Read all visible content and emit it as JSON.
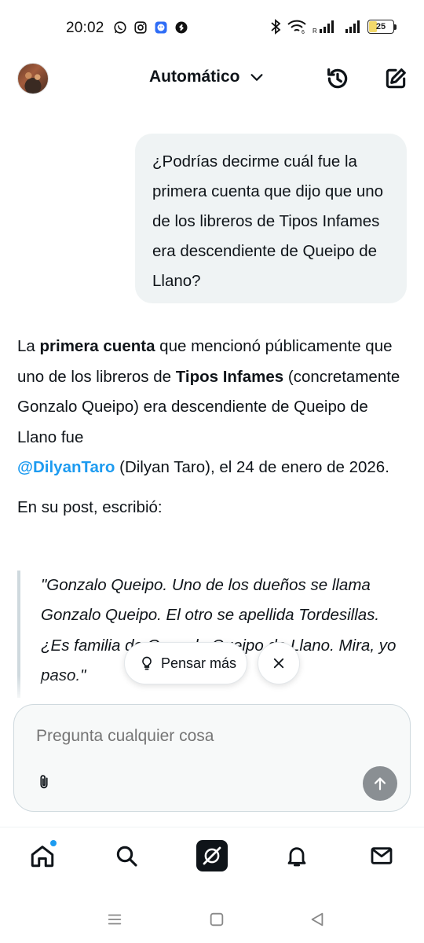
{
  "status_bar": {
    "time": "20:02",
    "battery": "25",
    "app_icons": [
      "whatsapp-icon",
      "instagram-icon",
      "bot-app-icon",
      "shazam-icon"
    ],
    "system_icons": [
      "bluetooth-icon",
      "wifi-icon",
      "signal-icon",
      "signal-icon"
    ],
    "colors": {
      "battery_fill": "#f3d96b"
    }
  },
  "header": {
    "model_label": "Automático",
    "icons": {
      "avatar": "user-avatar",
      "dropdown": "chevron-down-icon",
      "history": "history-icon",
      "new_chat": "compose-icon"
    }
  },
  "conversation": {
    "user_message": "¿Podrías decirme cuál fue la primera cuenta que dijo que uno de los libreros de Tipos Infames era descendiente de Queipo de Llano?",
    "response": {
      "p1_t1": "La ",
      "p1_b1": "primera cuenta",
      "p1_t2": " que mencionó públicamente que uno de los libreros de ",
      "p1_b2": "Tipos Infames",
      "p1_t3": " (concretamente Gonzalo Queipo) era descendiente de Queipo de Llano fue ",
      "p1_mention": "@DilyanTaro",
      "p1_t4": " (Dilyan Taro), el 24 de enero de 2026.",
      "p2": "En su post, escribió:",
      "quote": "\"Gonzalo Queipo. Uno de los dueños se llama Gonzalo Queipo. El otro se apellida Tordesillas. ¿Es familia de Gonzalo Queipo de Llano. Mira, yo paso.\""
    }
  },
  "chips": {
    "think_more": "Pensar más",
    "think_icon": "lightbulb-icon",
    "close_icon": "close-icon"
  },
  "composer": {
    "placeholder": "Pregunta cualquier cosa",
    "attach_icon": "paperclip-icon",
    "send_icon": "arrow-up-icon"
  },
  "tab_bar": {
    "items": [
      "home-icon",
      "search-icon",
      "grok-icon",
      "notifications-icon",
      "messages-icon"
    ],
    "colors": {
      "badge": "#1d9bf0"
    }
  },
  "nav_bar": {
    "items": [
      "recents-icon",
      "home-nav-icon",
      "back-icon"
    ]
  },
  "colors": {
    "text": "#0f1419",
    "link": "#1d9bf0",
    "bubble": "#eff3f4",
    "send_button": "#8a8f93"
  }
}
